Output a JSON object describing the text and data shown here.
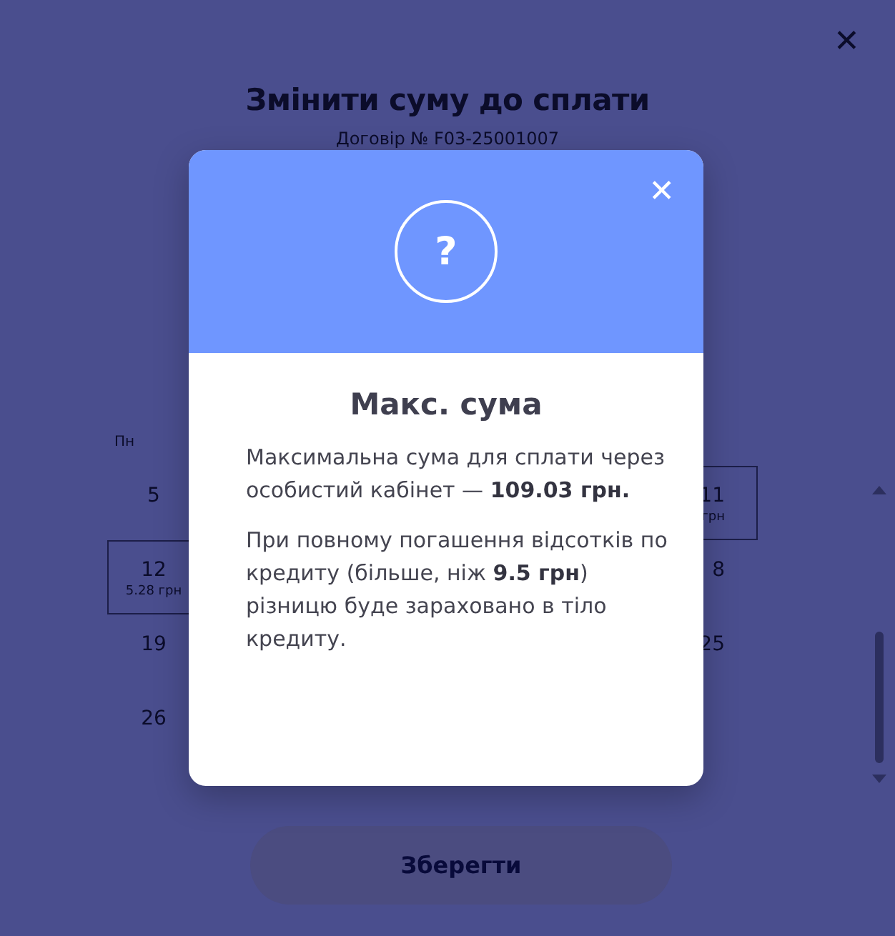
{
  "page": {
    "title": "Змінити суму до сплати",
    "subtitle": "Договір № F03-25001007",
    "close_icon": "✕"
  },
  "calendar": {
    "weekday": "Пн",
    "rows": [
      {
        "cells": [
          {
            "day": "5",
            "selected": false
          },
          {
            "day": "11",
            "amount": "грн",
            "selected": true
          }
        ]
      },
      {
        "cells": [
          {
            "day": "12",
            "amount": "5.28 грн",
            "selected": true
          },
          {
            "day": "8",
            "selected": false
          }
        ]
      },
      {
        "cells": [
          {
            "day": "19",
            "selected": false
          },
          {
            "day": "25",
            "selected": false
          }
        ]
      },
      {
        "cells": [
          {
            "day": "26",
            "selected": false
          }
        ]
      }
    ]
  },
  "save_button": "Зберегти",
  "dialog": {
    "close": "✕",
    "icon": "?",
    "title": "Макс. сума",
    "paragraphs": [
      "Максимальна сума для сплати через особистий кабінет — **109.03 грн.**",
      "При повному погашення відсотків по кредиту (більше, ніж **9.5 грн**) різницю буде зараховано в тіло кредиту."
    ]
  }
}
